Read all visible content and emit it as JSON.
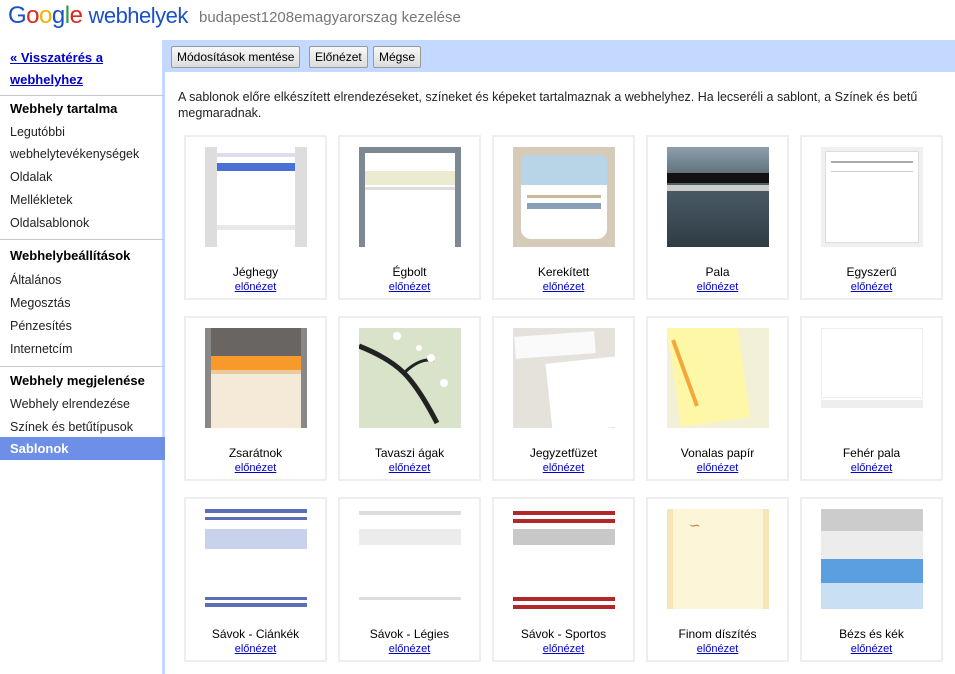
{
  "header": {
    "logo_product": "webhelyek",
    "site_title": "budapest1208emagyarorszag kezelése"
  },
  "sidebar": {
    "back_link": "« Visszatérés a webhelyhez",
    "sections": [
      {
        "heading": "Webhely tartalma",
        "items": [
          "Legutóbbi webhelytevékenységek",
          "Oldalak",
          "Mellékletek",
          "Oldalsablonok"
        ]
      },
      {
        "heading": "Webhelybeállítások",
        "items": [
          "Általános",
          "Megosztás",
          "Pénzesítés",
          "Internetcím"
        ]
      },
      {
        "heading": "Webhely megjelenése",
        "items": [
          "Webhely elrendezése",
          "Színek és betűtípusok"
        ]
      }
    ],
    "selected": "Sablonok",
    "accent_color": "#6e8fe8"
  },
  "toolbar": {
    "save_label": "Módosítások mentése",
    "preview_label": "Előnézet",
    "cancel_label": "Mégse"
  },
  "main": {
    "description": "A sablonok előre elkészített elrendezéseket, színeket és képeket tartalmaznak a webhelyhez. Ha lecseréli a sablont, a Színek és betű megmaradnak.",
    "preview_link": "előnézet",
    "templates": [
      {
        "name": "Jéghegy"
      },
      {
        "name": "Égbolt"
      },
      {
        "name": "Kerekített"
      },
      {
        "name": "Pala"
      },
      {
        "name": "Egyszerű"
      },
      {
        "name": "Zsarátnok"
      },
      {
        "name": "Tavaszi ágak"
      },
      {
        "name": "Jegyzetfüzet"
      },
      {
        "name": "Vonalas papír"
      },
      {
        "name": "Fehér pala"
      },
      {
        "name": "Sávok - Ciánkék"
      },
      {
        "name": "Sávok - Légies"
      },
      {
        "name": "Sávok - Sportos"
      },
      {
        "name": "Finom díszítés"
      },
      {
        "name": "Bézs és kék"
      }
    ]
  }
}
